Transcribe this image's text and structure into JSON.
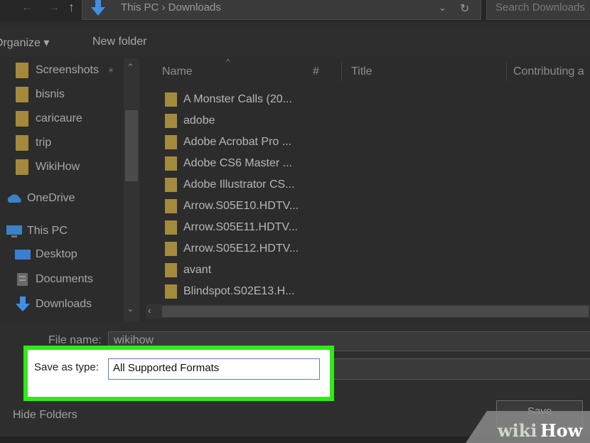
{
  "address": {
    "path": "This PC  ›  Downloads",
    "search_placeholder": "Search Downloads"
  },
  "toolbar": {
    "organize": "Organize ▾",
    "new_folder": "New folder"
  },
  "nav": {
    "items": [
      {
        "label": "Screenshots",
        "icon": "folder-icon"
      },
      {
        "label": "bisnis",
        "icon": "folder-icon"
      },
      {
        "label": "caricaure",
        "icon": "folder-icon"
      },
      {
        "label": "trip",
        "icon": "folder-icon"
      },
      {
        "label": "WikiHow",
        "icon": "folder-icon"
      },
      {
        "label": "OneDrive",
        "icon": "cloud-icon"
      },
      {
        "label": "This PC",
        "icon": "computer-icon"
      },
      {
        "label": "Desktop",
        "icon": "desktop-icon"
      },
      {
        "label": "Documents",
        "icon": "document-icon"
      },
      {
        "label": "Downloads",
        "icon": "download-icon"
      }
    ]
  },
  "list": {
    "columns": [
      "Name",
      "#",
      "Title",
      "Contributing a"
    ],
    "files": [
      "A Monster Calls (20...",
      "adobe",
      "Adobe Acrobat Pro ...",
      "Adobe CS6 Master ...",
      "Adobe Illustrator CS...",
      "Arrow.S05E10.HDTV...",
      "Arrow.S05E11.HDTV...",
      "Arrow.S05E12.HDTV...",
      "avant",
      "Blindspot.S02E13.H..."
    ]
  },
  "form": {
    "file_name_label": "File name:",
    "file_name_value": "wikihow",
    "save_as_type_label": "Save as type:",
    "save_as_type_value": "All Supported Formats"
  },
  "footer": {
    "hide_folders": "Hide Folders",
    "save": "Save"
  },
  "watermark": {
    "wiki": "wiki",
    "how": "How"
  },
  "colors": {
    "highlight": "#2fea16",
    "folder": "#a48a3e"
  }
}
